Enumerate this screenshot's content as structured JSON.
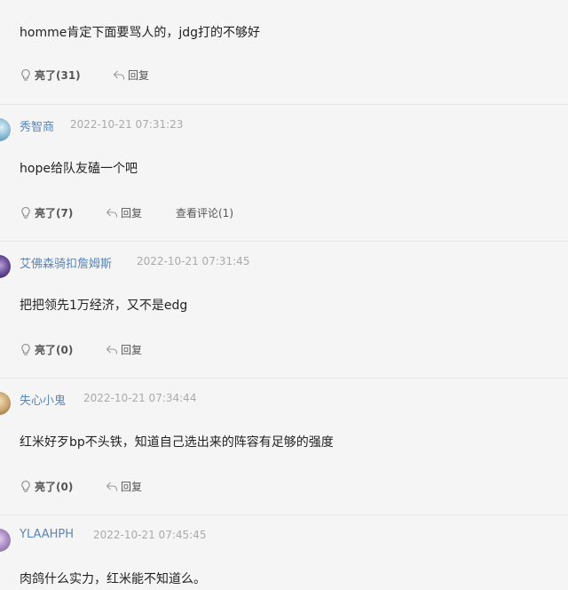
{
  "comments": [
    {
      "username": "",
      "timestamp": "",
      "text": "homme肯定下面要骂人的，jdg打的不够好",
      "like_label": "亮了(31)",
      "reply_label": "回复",
      "view_label": ""
    },
    {
      "username": "秀智商",
      "timestamp": "2022-10-21 07:31:23",
      "text": "hope给队友磕一个吧",
      "like_label": "亮了(7)",
      "reply_label": "回复",
      "view_label": "查看评论(1)"
    },
    {
      "username": "艾佛森骑扣詹姆斯",
      "timestamp": "2022-10-21 07:31:45",
      "text": "把把领先1万经济，又不是edg",
      "like_label": "亮了(0)",
      "reply_label": "回复",
      "view_label": ""
    },
    {
      "username": "失心小鬼",
      "timestamp": "2022-10-21 07:34:44",
      "text": "红米好歹bp不头铁，知道自己选出来的阵容有足够的强度",
      "like_label": "亮了(0)",
      "reply_label": "回复",
      "view_label": ""
    },
    {
      "username": "YLAAHPH",
      "timestamp": "2022-10-21 07:45:45",
      "text": "肉鸽什么实力，红米能不知道么。",
      "like_label": "",
      "reply_label": "",
      "view_label": ""
    }
  ],
  "icons": {
    "like": "lightbulb-icon",
    "reply": "reply-arrow-icon"
  },
  "colors": {
    "username": "#5a86b8",
    "timestamp": "#aaaaaa",
    "divider": "#e6e6e6",
    "background": "#f5f5f5"
  }
}
